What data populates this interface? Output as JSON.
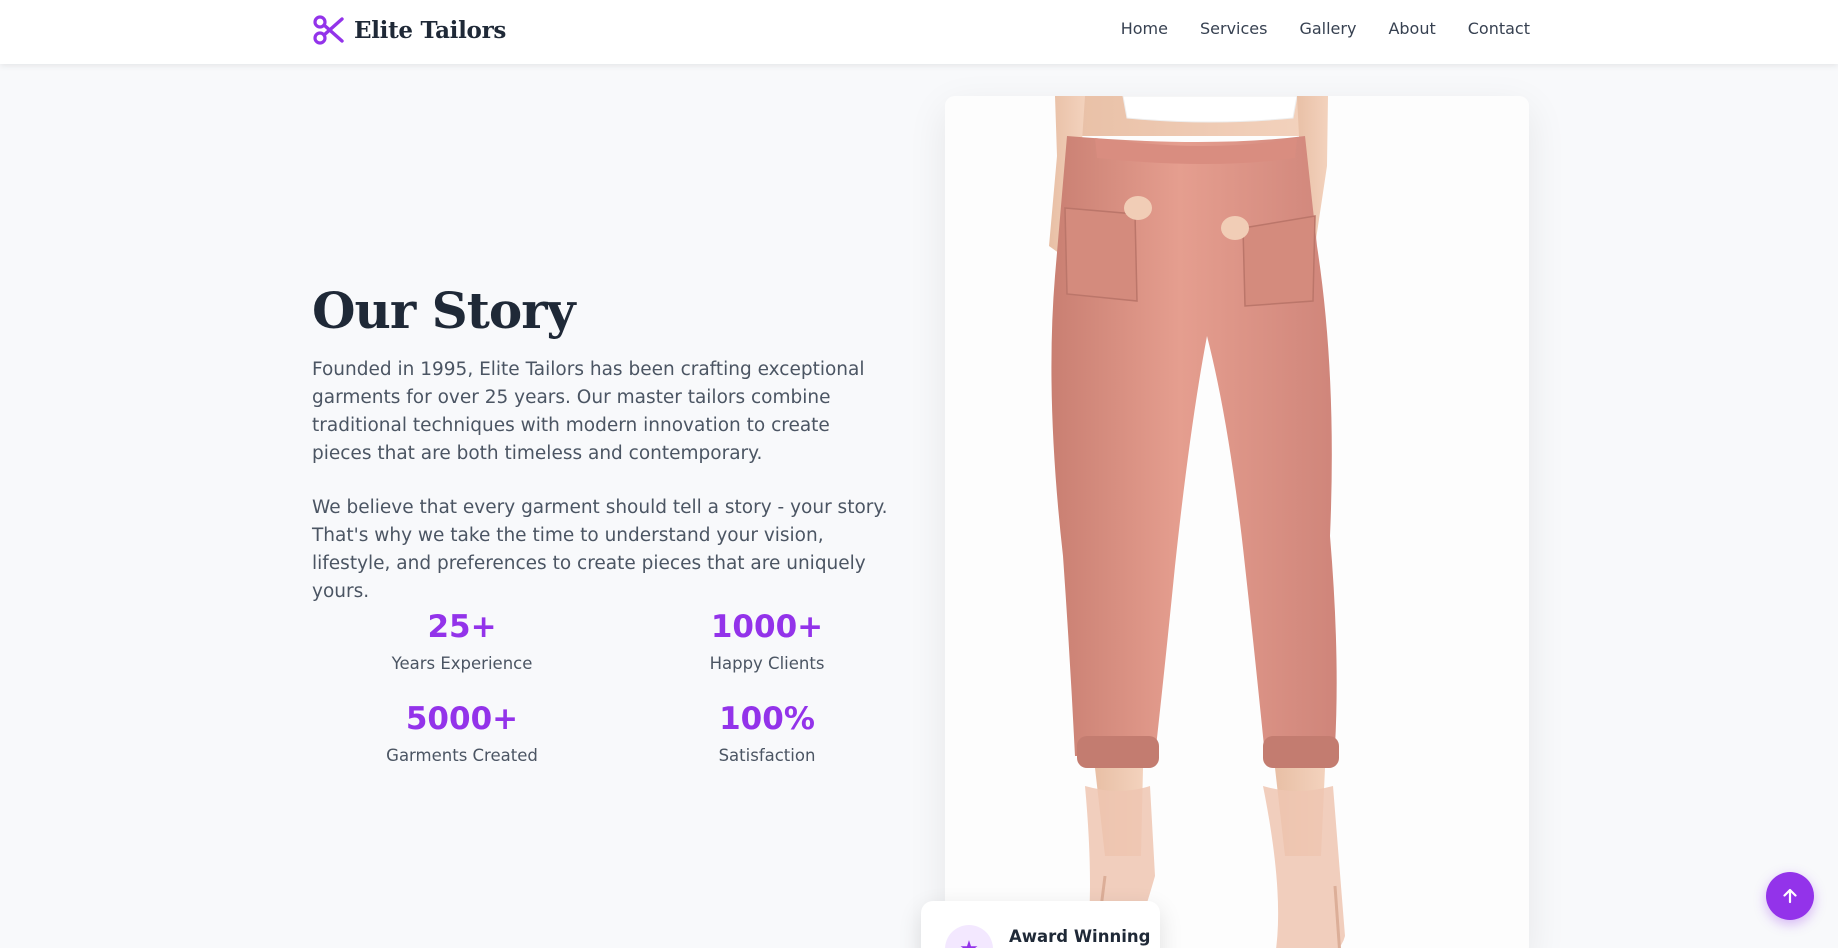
{
  "brand": {
    "name": "Elite Tailors",
    "icon": "scissors-icon",
    "accent_color": "#9333ea"
  },
  "nav": {
    "items": [
      {
        "label": "Home"
      },
      {
        "label": "Services"
      },
      {
        "label": "Gallery"
      },
      {
        "label": "About"
      },
      {
        "label": "Contact"
      }
    ]
  },
  "story": {
    "title": "Our Story",
    "paragraphs": [
      "Founded in 1995, Elite Tailors has been crafting exceptional garments for over 25 years. Our master tailors combine traditional techniques with modern innovation to create pieces that are both timeless and contemporary.",
      "We believe that every garment should tell a story - your story. That's why we take the time to understand your vision, lifestyle, and preferences to create pieces that are uniquely yours."
    ]
  },
  "stats": [
    {
      "value": "25+",
      "label": "Years Experience"
    },
    {
      "value": "1000+",
      "label": "Happy Clients"
    },
    {
      "value": "5000+",
      "label": "Garments Created"
    },
    {
      "value": "100%",
      "label": "Satisfaction"
    }
  ],
  "award": {
    "title": "Award Winning",
    "icon": "award-icon"
  },
  "back_to_top": {
    "icon": "arrow-up-icon"
  }
}
